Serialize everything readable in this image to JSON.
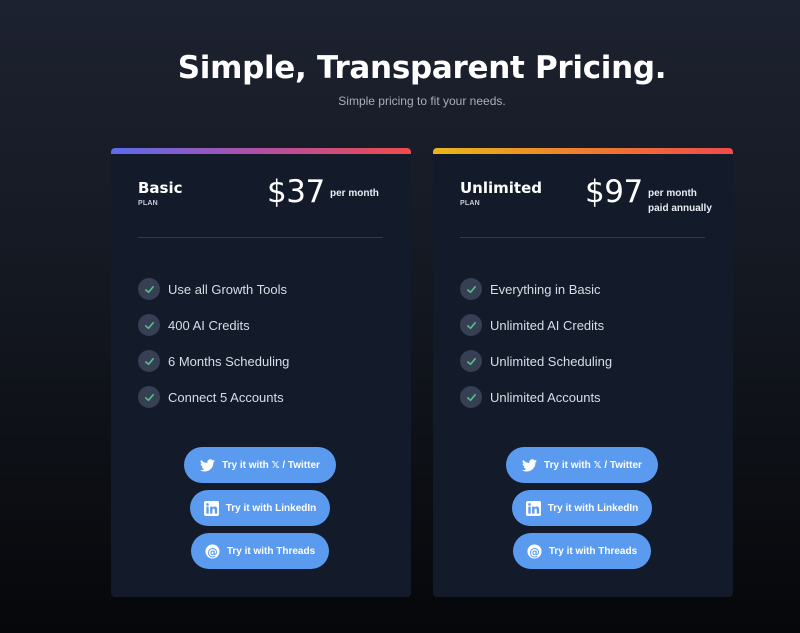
{
  "header": {
    "title": "Simple, Transparent Pricing.",
    "subtitle": "Simple pricing to fit your needs."
  },
  "plans": [
    {
      "name": "Basic",
      "tag": "PLAN",
      "price": "$37",
      "period_line1": "per month",
      "period_line2": "",
      "features": [
        "Use all Growth Tools",
        "400 AI Credits",
        "6 Months Scheduling",
        "Connect 5 Accounts"
      ],
      "buttons": {
        "twitter": "Try it with 𝕏 / Twitter",
        "linkedin": "Try it with LinkedIn",
        "threads": "Try it with Threads"
      }
    },
    {
      "name": "Unlimited",
      "tag": "PLAN",
      "price": "$97",
      "period_line1": "per month",
      "period_line2": "paid annually",
      "features": [
        "Everything in Basic",
        "Unlimited AI Credits",
        "Unlimited Scheduling",
        "Unlimited Accounts"
      ],
      "buttons": {
        "twitter": "Try it with 𝕏 / Twitter",
        "linkedin": "Try it with LinkedIn",
        "threads": "Try it with Threads"
      }
    }
  ],
  "colors": {
    "button": "#5b9bef",
    "check": "#4fc08d",
    "card": "#131a2a"
  }
}
